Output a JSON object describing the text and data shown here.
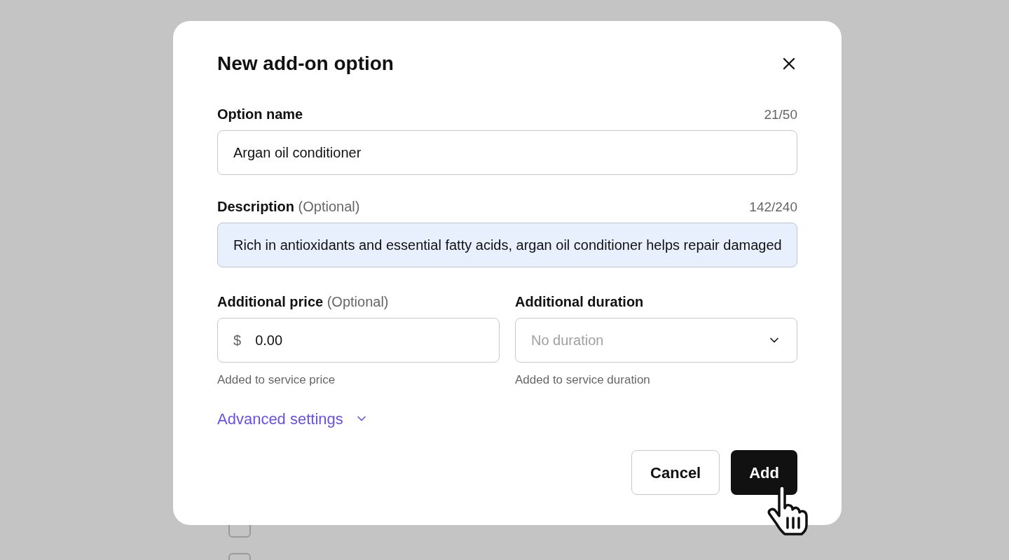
{
  "background": {
    "options": [
      {
        "checked": false
      },
      {
        "checked": false
      }
    ]
  },
  "dialog": {
    "title": "New add-on option",
    "fields": [
      {
        "label": "Option name",
        "count": "21/50",
        "value": "Argan oil conditioner",
        "focused": false
      },
      {
        "label": "Description",
        "optional": "(Optional)",
        "count": "142/240",
        "value": "Rich in antioxidants and essential fatty acids, argan oil conditioner helps repair damaged",
        "focused": true
      }
    ],
    "price": {
      "label": "Additional price",
      "optional": "(Optional)",
      "prefix": "$",
      "value": "0.00",
      "hint": "Added to service price"
    },
    "duration": {
      "label": "Additional duration",
      "placeholder": "No duration",
      "hint": "Added to service duration"
    },
    "advanced": {
      "label": "Advanced settings",
      "expanded": false
    },
    "buttons": [
      {
        "label": "Cancel",
        "kind": "secondary"
      },
      {
        "label": "Add",
        "kind": "primary"
      }
    ]
  }
}
